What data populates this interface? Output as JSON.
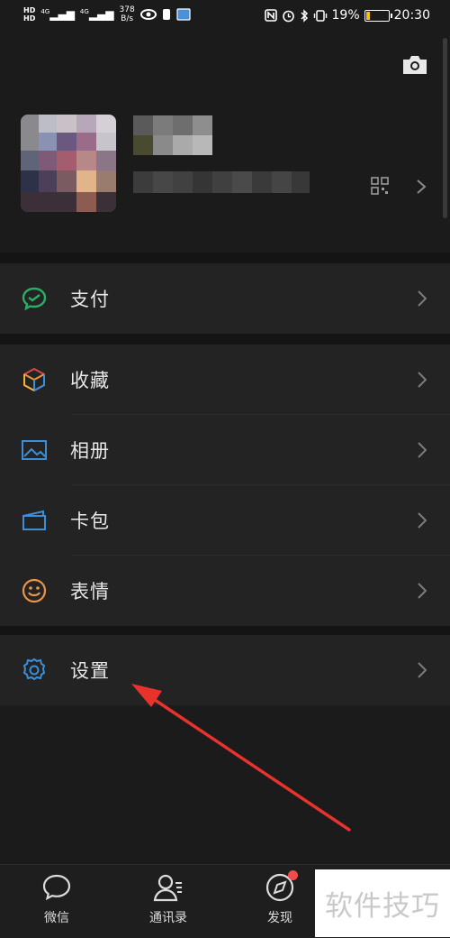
{
  "status_bar": {
    "hd1": "HD",
    "hd2": "HD",
    "signal1": "4G",
    "signal2": "4G",
    "speed_value": "378",
    "speed_unit": "B/s",
    "battery_percent": "19%",
    "battery_level": 0.19,
    "time": "20:30"
  },
  "profile": {
    "camera_icon": "camera-icon",
    "qr_icon": "qr-code-icon"
  },
  "menu": {
    "pay": {
      "label": "支付",
      "icon": "pay-icon",
      "color": "#2aae67"
    },
    "favorites": {
      "label": "收藏",
      "icon": "cube-icon"
    },
    "album": {
      "label": "相册",
      "icon": "photo-icon",
      "color": "#3a8fd6"
    },
    "card": {
      "label": "卡包",
      "icon": "wallet-icon",
      "color": "#3a8fd6"
    },
    "sticker": {
      "label": "表情",
      "icon": "smile-icon",
      "color": "#e8944a"
    },
    "settings": {
      "label": "设置",
      "icon": "gear-icon",
      "color": "#3a8fd6"
    }
  },
  "tabbar": {
    "chats": "微信",
    "contacts": "通讯录",
    "discover": "发现"
  },
  "watermark": "软件技巧",
  "annotation_color": "#e8322b"
}
